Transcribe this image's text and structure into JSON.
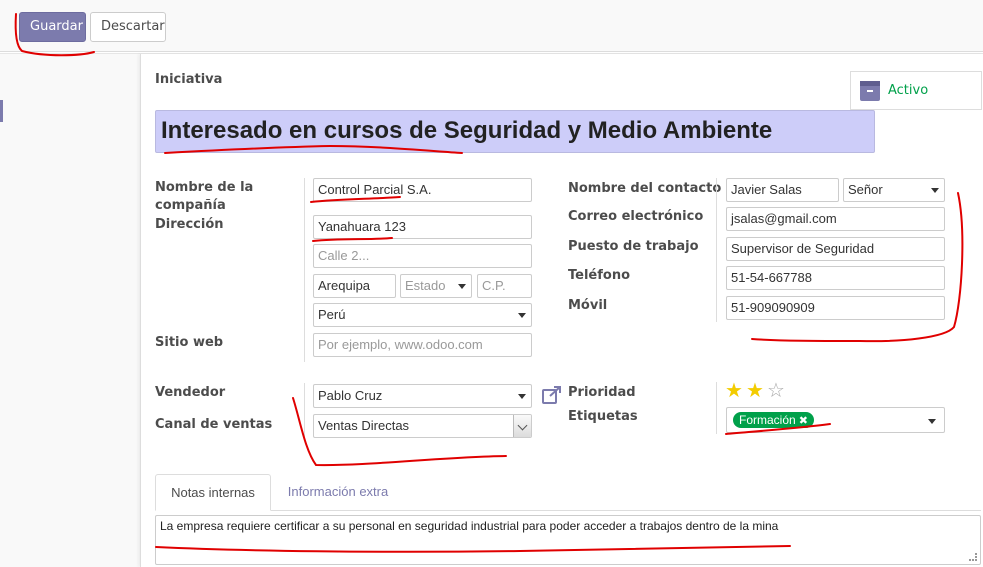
{
  "toolbar": {
    "save_label": "Guardar",
    "discard_label": "Descartar"
  },
  "status": {
    "label": "Activo",
    "icon": "archive-icon"
  },
  "form": {
    "type_label": "Iniciativa",
    "title": "Interesado en cursos de Seguridad y Medio Ambiente",
    "company_label_1": "Nombre de la",
    "company_label_2": "compañía",
    "company_value": "Control Parcial S.A.",
    "address_label": "Dirección",
    "street": "Yanahuara 123",
    "street2_placeholder": "Calle 2...",
    "city": "Arequipa",
    "state_placeholder": "Estado",
    "zip_placeholder": "C.P.",
    "country": "Perú",
    "website_label": "Sitio web",
    "website_placeholder": "Por ejemplo, www.odoo.com",
    "contact_label": "Nombre del contacto",
    "contact_name": "Javier Salas",
    "contact_title": "Señor",
    "email_label": "Correo electrónico",
    "email": "jsalas@gmail.com",
    "job_label": "Puesto de trabajo",
    "job": "Supervisor de Seguridad",
    "phone_label": "Teléfono",
    "phone": "51-54-667788",
    "mobile_label": "Móvil",
    "mobile": "51-909090909",
    "salesperson_label": "Vendedor",
    "salesperson": "Pablo Cruz",
    "channel_label": "Canal de ventas",
    "channel": "Ventas Directas",
    "priority_label": "Prioridad",
    "priority": {
      "value": 2,
      "max": 3
    },
    "tags_label": "Etiquetas",
    "tags": [
      "Formación"
    ]
  },
  "tabs": {
    "notes": "Notas internas",
    "extra": "Información extra"
  },
  "notes_text": "La empresa requiere certificar a su personal en seguridad industrial para poder acceder a trabajos dentro de la mina",
  "colors": {
    "primary": "#7c7bad",
    "title_bg": "#cdcdf9",
    "active_green": "#00a04a",
    "star": "#f3cc00",
    "annotation_red": "#e00000"
  }
}
